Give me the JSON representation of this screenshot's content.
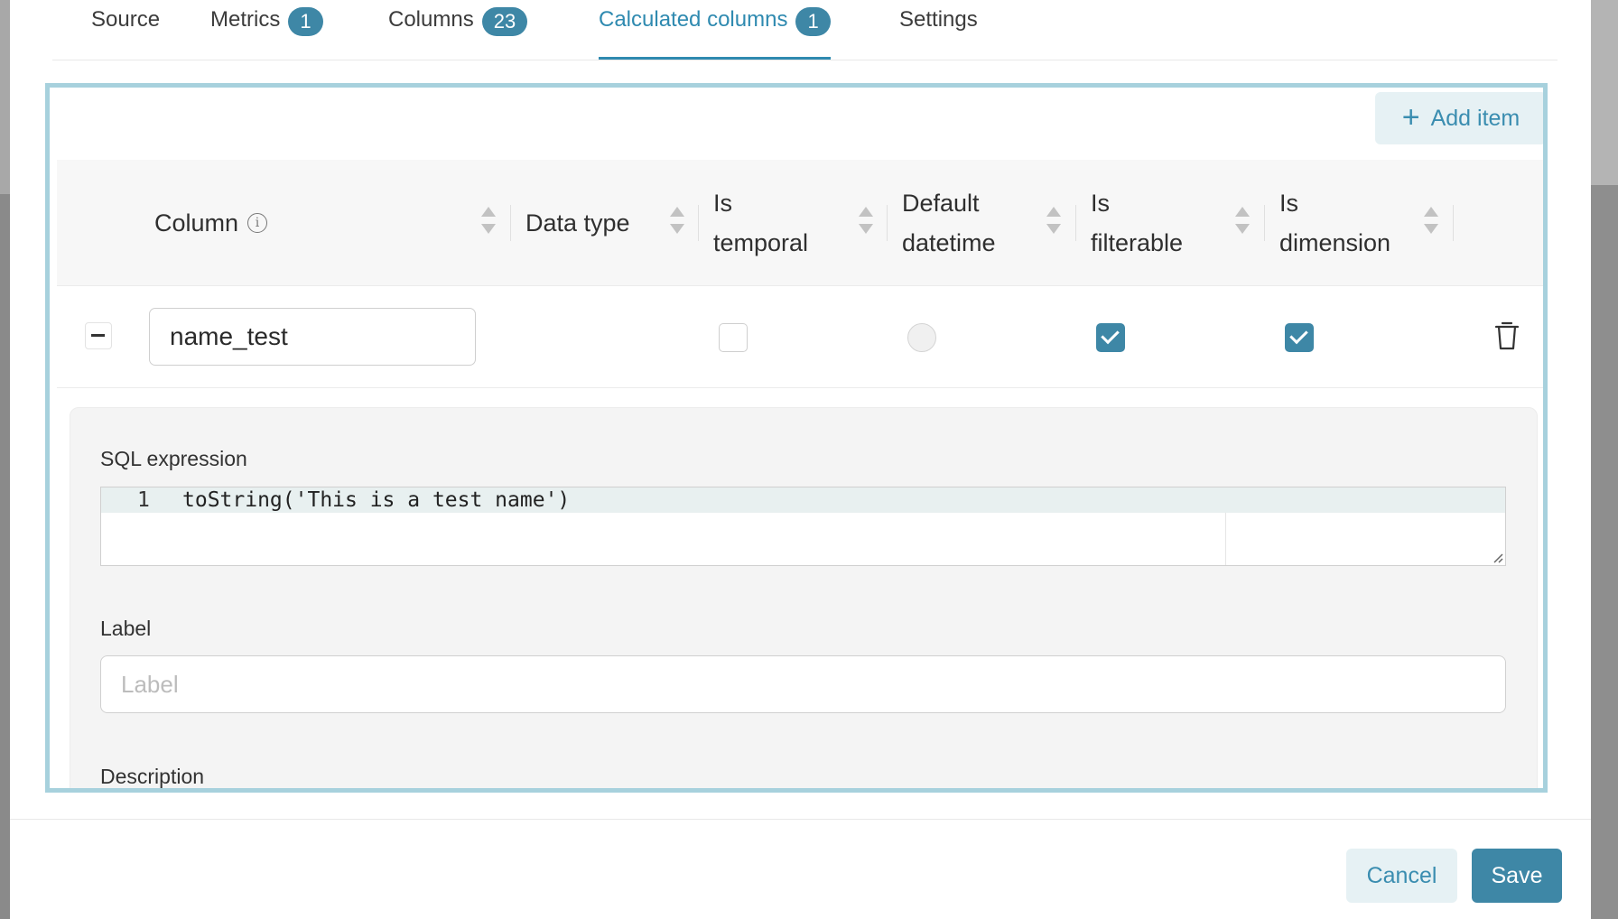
{
  "tabs": [
    {
      "label": "Source",
      "badge": ""
    },
    {
      "label": "Metrics",
      "badge": "1"
    },
    {
      "label": "Columns",
      "badge": "23"
    },
    {
      "label": "Calculated columns",
      "badge": "1",
      "active": true
    },
    {
      "label": "Settings",
      "badge": ""
    }
  ],
  "toolbar": {
    "add_item_label": "Add item"
  },
  "table": {
    "headers": {
      "column": "Column",
      "data_type": "Data type",
      "is_temporal": [
        "Is",
        "temporal"
      ],
      "default_datetime": [
        "Default",
        "datetime"
      ],
      "is_filterable": [
        "Is",
        "filterable"
      ],
      "is_dimension": [
        "Is",
        "dimension"
      ]
    },
    "row": {
      "column_name": "name_test",
      "is_temporal": false,
      "default_datetime": false,
      "is_filterable": true,
      "is_dimension": true
    }
  },
  "details": {
    "sql_label": "SQL expression",
    "sql_line_number": "1",
    "sql_code": "toString('This is a test name')",
    "label_label": "Label",
    "label_placeholder": "Label",
    "description_label": "Description"
  },
  "footer": {
    "cancel_label": "Cancel",
    "save_label": "Save"
  },
  "colors": {
    "accent": "#3e87a6",
    "panel_border": "#a7d1dd",
    "button_light": "#e6f1f4"
  }
}
